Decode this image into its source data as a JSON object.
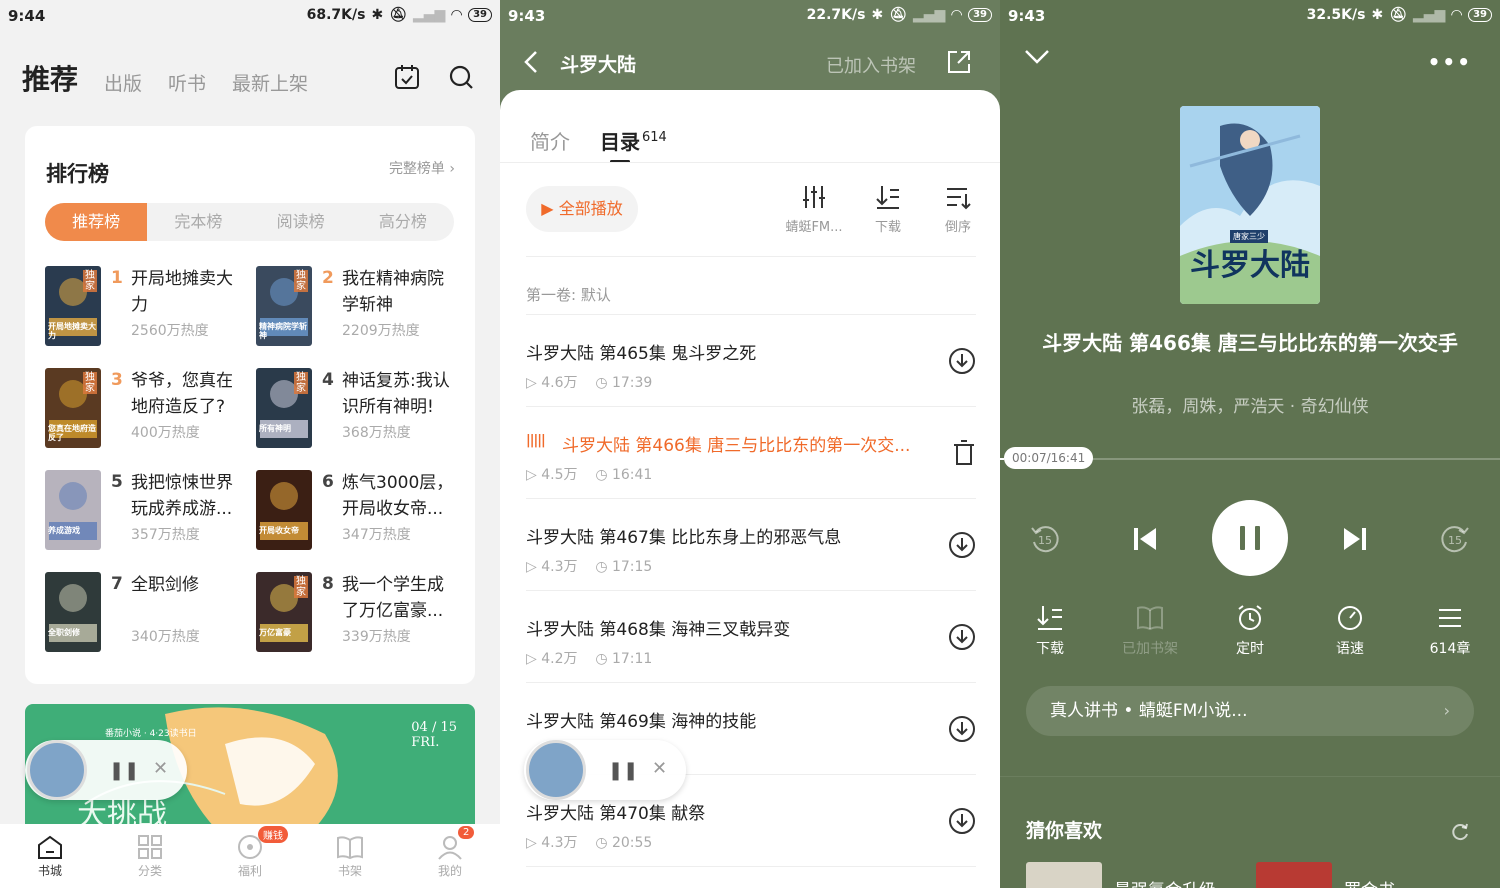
{
  "panel1": {
    "status": {
      "time": "9:44",
      "speed": "68.7K/s",
      "battery": "39"
    },
    "nav": {
      "active": "推荐",
      "tabs": [
        "出版",
        "听书",
        "最新上架"
      ]
    },
    "rank": {
      "title": "排行榜",
      "more": "完整榜单 ›",
      "tabs": [
        "推荐榜",
        "完本榜",
        "阅读榜",
        "高分榜"
      ],
      "books": [
        {
          "rank": "1",
          "name": "开局地摊卖大力",
          "heat": "2560万热度",
          "tag": "独家",
          "cover_title": "开局地摊卖大力"
        },
        {
          "rank": "2",
          "name": "我在精神病院学斩神",
          "heat": "2209万热度",
          "tag": "独家",
          "cover_title": "精神病院学斩神"
        },
        {
          "rank": "3",
          "name": "爷爷，您真在地府造反了?",
          "heat": "400万热度",
          "tag": "独家",
          "cover_title": "您真在地府造反了"
        },
        {
          "rank": "4",
          "name": "神话复苏:我认识所有神明!",
          "heat": "368万热度",
          "tag": "独家",
          "cover_title": "所有神明"
        },
        {
          "rank": "5",
          "name": "我把惊悚世界玩成养成游...",
          "heat": "357万热度",
          "tag": "",
          "cover_title": "养成游戏"
        },
        {
          "rank": "6",
          "name": "炼气3000层，开局收女帝...",
          "heat": "347万热度",
          "tag": "",
          "cover_title": "开局收女帝"
        },
        {
          "rank": "7",
          "name": "全职剑修",
          "heat": "340万热度",
          "tag": "",
          "cover_title": "全职剑修"
        },
        {
          "rank": "8",
          "name": "我一个学生成了万亿富豪...",
          "heat": "339万热度",
          "tag": "独家",
          "cover_title": "万亿富豪"
        }
      ]
    },
    "banner": {
      "brand": "番茄小说 · 4·23读书日",
      "date": "04 / 15",
      "weekday": "FRI.",
      "text": "大挑战"
    },
    "bottom_nav": [
      {
        "label": "书城",
        "badge": ""
      },
      {
        "label": "分类",
        "badge": ""
      },
      {
        "label": "福利",
        "badge": "赚钱"
      },
      {
        "label": "书架",
        "badge": ""
      },
      {
        "label": "我的",
        "badge": "2"
      }
    ]
  },
  "panel2": {
    "status": {
      "time": "9:43",
      "speed": "22.7K/s",
      "battery": "39"
    },
    "header": {
      "title": "斗罗大陆",
      "added": "已加入书架"
    },
    "tabs": {
      "intro": "简介",
      "toc": "目录",
      "count": "614"
    },
    "play_all": "全部播放",
    "tools": [
      "蜻蜓FM...",
      "下载",
      "倒序"
    ],
    "volume": "第一卷: 默认",
    "episodes": [
      {
        "title": "斗罗大陆 第465集 鬼斗罗之死",
        "plays": "4.6万",
        "duration": "17:39"
      },
      {
        "title": "斗罗大陆 第466集 唐三与比比东的第一次交...",
        "plays": "4.5万",
        "duration": "16:41"
      },
      {
        "title": "斗罗大陆 第467集 比比东身上的邪恶气息",
        "plays": "4.3万",
        "duration": "17:15"
      },
      {
        "title": "斗罗大陆 第468集 海神三叉戟异变",
        "plays": "4.2万",
        "duration": "17:11"
      },
      {
        "title": "斗罗大陆 第469集 海神的技能",
        "plays": "",
        "duration": ""
      },
      {
        "title": "斗罗大陆 第470集 献祭",
        "plays": "4.3万",
        "duration": "20:55"
      }
    ],
    "current_index": 1
  },
  "panel3": {
    "status": {
      "time": "9:43",
      "speed": "32.5K/s",
      "battery": "39"
    },
    "cover_text": "斗罗大陆",
    "cover_author": "唐家三少",
    "title": "斗罗大陆 第466集 唐三与比比东的第一次交手",
    "subtitle": "张磊，周姝，严浩天 · 奇幻仙侠",
    "time": "00:07/16:41",
    "progress": 0.007,
    "functions": [
      "下载",
      "已加书架",
      "定时",
      "语速",
      "614章"
    ],
    "tts": "真人讲书 • 蜻蜓FM小说...",
    "tts_arrow": "›",
    "guess_title": "猜你喜欢",
    "recs": [
      "最强氪金升级",
      "罪金书"
    ]
  },
  "colors": {
    "accent": "#f06a2a",
    "rank_orange": "#f08a4b",
    "player_bg": "#5f7351"
  }
}
